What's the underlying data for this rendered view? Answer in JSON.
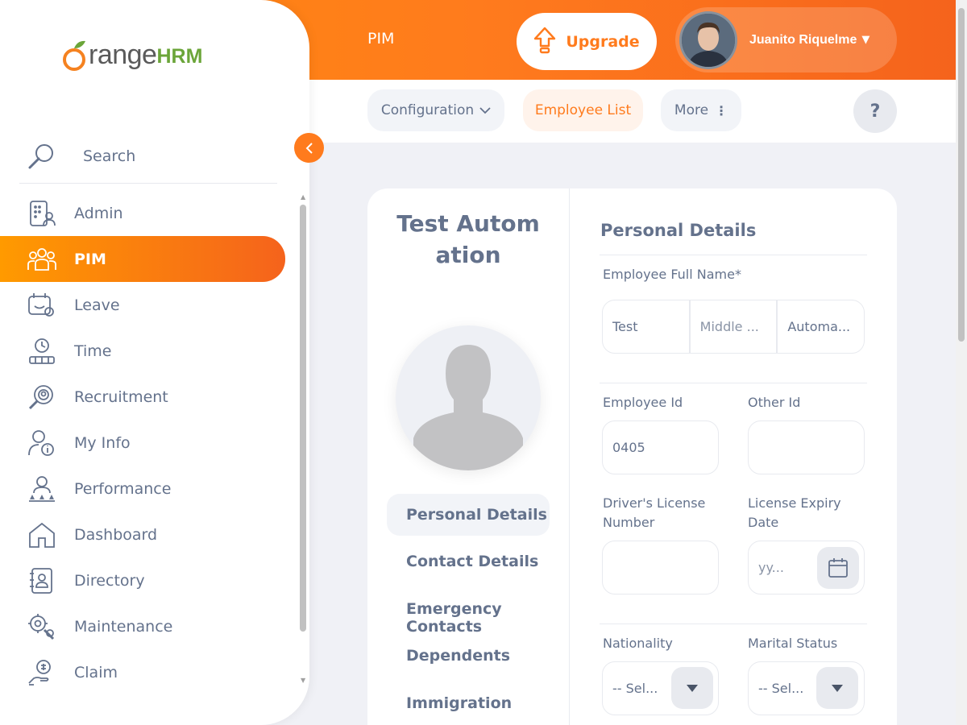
{
  "header": {
    "module": "PIM",
    "upgrade_label": "Upgrade",
    "user_name": "Juanito Riquelme"
  },
  "subnav": {
    "items": [
      {
        "label": "Configuration"
      },
      {
        "label": "Employee List"
      },
      {
        "label": "More"
      }
    ],
    "help": "?"
  },
  "sidebar": {
    "logo_main": "OrangeHRM",
    "logo_text": "range",
    "logo_hrm": "HRM",
    "search_label": "Search",
    "items": [
      {
        "label": "Admin",
        "icon": "admin-icon"
      },
      {
        "label": "PIM",
        "icon": "pim-icon",
        "active": true
      },
      {
        "label": "Leave",
        "icon": "leave-icon"
      },
      {
        "label": "Time",
        "icon": "time-icon"
      },
      {
        "label": "Recruitment",
        "icon": "recruitment-icon"
      },
      {
        "label": "My Info",
        "icon": "my-info-icon"
      },
      {
        "label": "Performance",
        "icon": "performance-icon"
      },
      {
        "label": "Dashboard",
        "icon": "dashboard-icon"
      },
      {
        "label": "Directory",
        "icon": "directory-icon"
      },
      {
        "label": "Maintenance",
        "icon": "maintenance-icon"
      },
      {
        "label": "Claim",
        "icon": "claim-icon"
      }
    ]
  },
  "profile": {
    "employee_name": "Test Automation",
    "tabs": [
      {
        "label": "Personal Details"
      },
      {
        "label": "Contact Details"
      },
      {
        "label": "Emergency Contacts"
      },
      {
        "label": "Dependents"
      },
      {
        "label": "Immigration"
      }
    ]
  },
  "personal_details": {
    "title": "Personal Details",
    "full_name_label": "Employee Full Name*",
    "first_name": "Test",
    "middle_name_placeholder": "Middle ...",
    "last_name": "Automa...",
    "employee_id_label": "Employee Id",
    "employee_id": "0405",
    "other_id_label": "Other Id",
    "other_id": "",
    "license_label": "Driver's License Number",
    "license_value": "",
    "license_expiry_label": "License Expiry Date",
    "license_expiry_placeholder": "yy...",
    "nationality_label": "Nationality",
    "nationality_value": "-- Sel...",
    "marital_label": "Marital Status",
    "marital_value": "-- Sel..."
  },
  "colors": {
    "accent": "#ff7b1d",
    "text": "#64728c",
    "logo_green": "#6ba539"
  }
}
